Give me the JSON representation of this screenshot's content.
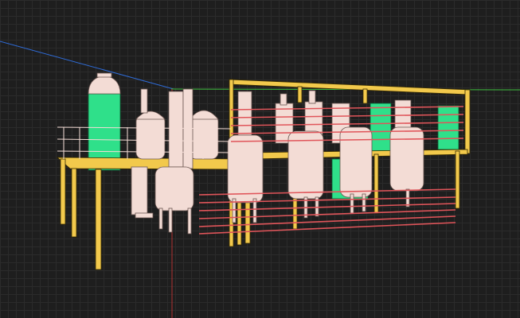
{
  "viewport": {
    "background": "#1e1e1e",
    "grid_color": "#2b2b2b"
  },
  "colors": {
    "frame": "#f2c94c",
    "frame_edge": "#3a2d00",
    "vessel": "#f3dcd5",
    "vessel_shade": "#d9b8ae",
    "column": "#2fe08a",
    "column_edge": "#0d5a33",
    "pipe_red": "#e0555a",
    "axis_blue": "#2f6bd6",
    "axis_green": "#3fbf3f",
    "axis_red": "#b03030"
  },
  "model": {
    "description_icon": "cube-icon"
  }
}
